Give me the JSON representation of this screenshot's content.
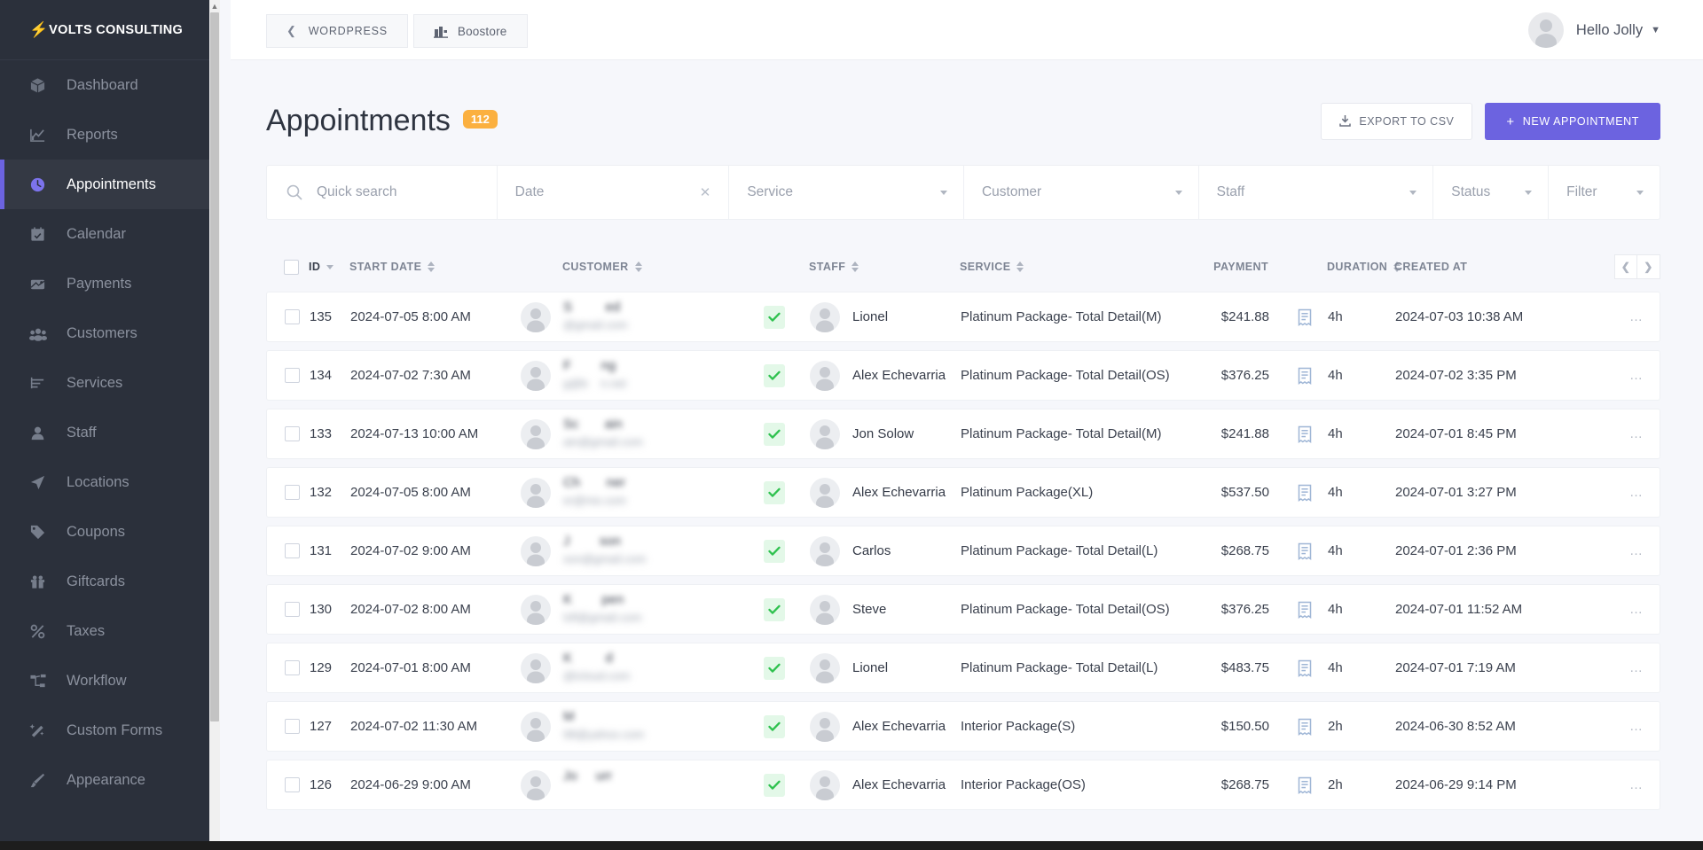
{
  "brand": {
    "name": "VOLTS CONSULTING",
    "bolt_icon": "bolt-icon"
  },
  "sidebar": {
    "items": [
      {
        "label": "Dashboard",
        "icon": "cube-icon",
        "active": false
      },
      {
        "label": "Reports",
        "icon": "chart-icon",
        "active": false
      },
      {
        "label": "Appointments",
        "icon": "clock-icon",
        "active": true
      },
      {
        "label": "Calendar",
        "icon": "calendar-icon",
        "active": false
      },
      {
        "label": "Payments",
        "icon": "wallet-icon",
        "active": false
      },
      {
        "label": "Customers",
        "icon": "people-icon",
        "active": false
      },
      {
        "label": "Services",
        "icon": "list-icon",
        "active": false
      },
      {
        "label": "Staff",
        "icon": "user-icon",
        "active": false
      },
      {
        "label": "Locations",
        "icon": "send-icon",
        "active": false
      },
      {
        "label": "Coupons",
        "icon": "tag-icon",
        "active": false
      },
      {
        "label": "Giftcards",
        "icon": "gift-icon",
        "active": false
      },
      {
        "label": "Taxes",
        "icon": "percent-icon",
        "active": false
      },
      {
        "label": "Workflow",
        "icon": "workflow-icon",
        "active": false
      },
      {
        "label": "Custom Forms",
        "icon": "wand-icon",
        "active": false
      },
      {
        "label": "Appearance",
        "icon": "brush-icon",
        "active": false
      }
    ]
  },
  "topbar": {
    "wordpress_label": "WORDPRESS",
    "store_label": "Boostore",
    "user_greeting": "Hello Jolly"
  },
  "page": {
    "title": "Appointments",
    "count_badge": "112",
    "export_label": "EXPORT TO CSV",
    "new_label": "NEW APPOINTMENT",
    "new_plus": "+"
  },
  "filters": {
    "search_placeholder": "Quick search",
    "search_value": "",
    "date_label": "Date",
    "service_label": "Service",
    "customer_label": "Customer",
    "staff_label": "Staff",
    "status_label": "Status",
    "filter_label": "Filter"
  },
  "table": {
    "headers": {
      "id": "ID",
      "start_date": "START DATE",
      "customer": "CUSTOMER",
      "staff": "STAFF",
      "service": "SERVICE",
      "payment": "PAYMENT",
      "duration": "DURATION",
      "created_at": "CREATED AT"
    },
    "rows": [
      {
        "id": "135",
        "start_date": "2024-07-05 8:00 AM",
        "customer_name": "S         ed",
        "customer_email": "@gmail.com",
        "status": "confirmed",
        "staff": "Lionel",
        "service": "Platinum Package- Total Detail(M)",
        "payment": "$241.88",
        "duration": "4h",
        "created_at": "2024-07-03 10:38 AM"
      },
      {
        "id": "134",
        "start_date": "2024-07-02 7:30 AM",
        "customer_name": "F        ng",
        "customer_email": "g@b    n.net",
        "status": "confirmed",
        "staff": "Alex Echevarria",
        "service": "Platinum Package- Total Detail(OS)",
        "payment": "$376.25",
        "duration": "4h",
        "created_at": "2024-07-02 3:35 PM"
      },
      {
        "id": "133",
        "start_date": "2024-07-13 10:00 AM",
        "customer_name": "Sc       ain",
        "customer_email": "ain@gmail.com",
        "status": "confirmed",
        "staff": "Jon Solow",
        "service": "Platinum Package- Total Detail(M)",
        "payment": "$241.88",
        "duration": "4h",
        "created_at": "2024-07-01 8:45 PM"
      },
      {
        "id": "132",
        "start_date": "2024-07-05 8:00 AM",
        "customer_name": "Ch       ner",
        "customer_email": "er@me.com",
        "status": "confirmed",
        "staff": "Alex Echevarria",
        "service": "Platinum Package(XL)",
        "payment": "$537.50",
        "duration": "4h",
        "created_at": "2024-07-01 3:27 PM"
      },
      {
        "id": "131",
        "start_date": "2024-07-02 9:00 AM",
        "customer_name": "J        son",
        "customer_email": "son@gmail.com",
        "status": "confirmed",
        "staff": "Carlos",
        "service": "Platinum Package- Total Detail(L)",
        "payment": "$268.75",
        "duration": "4h",
        "created_at": "2024-07-01 2:36 PM"
      },
      {
        "id": "130",
        "start_date": "2024-07-02 8:00 AM",
        "customer_name": "K        pen",
        "customer_email": "lsfl@gmail.com",
        "status": "confirmed",
        "staff": "Steve",
        "service": "Platinum Package- Total Detail(OS)",
        "payment": "$376.25",
        "duration": "4h",
        "created_at": "2024-07-01 11:52 AM"
      },
      {
        "id": "129",
        "start_date": "2024-07-01 8:00 AM",
        "customer_name": "K         d",
        "customer_email": "@icloud.com",
        "status": "confirmed",
        "staff": "Lionel",
        "service": "Platinum Package- Total Detail(L)",
        "payment": "$483.75",
        "duration": "4h",
        "created_at": "2024-07-01 7:19 AM"
      },
      {
        "id": "127",
        "start_date": "2024-07-02 11:30 AM",
        "customer_name": "M",
        "customer_email": "98@yahoo.com",
        "status": "confirmed",
        "staff": "Alex Echevarria",
        "service": "Interior Package(S)",
        "payment": "$150.50",
        "duration": "2h",
        "created_at": "2024-06-30 8:52 AM"
      },
      {
        "id": "126",
        "start_date": "2024-06-29 9:00 AM",
        "customer_name": "Jo     urr",
        "customer_email": "",
        "status": "confirmed",
        "staff": "Alex Echevarria",
        "service": "Interior Package(OS)",
        "payment": "$268.75",
        "duration": "2h",
        "created_at": "2024-06-29 9:14 PM"
      }
    ]
  },
  "colors": {
    "accent": "#6c63e0",
    "badge": "#fbb040",
    "sidebar_bg": "#2b303b",
    "ok_green": "#2ec14e",
    "bolt": "#f4603e"
  }
}
